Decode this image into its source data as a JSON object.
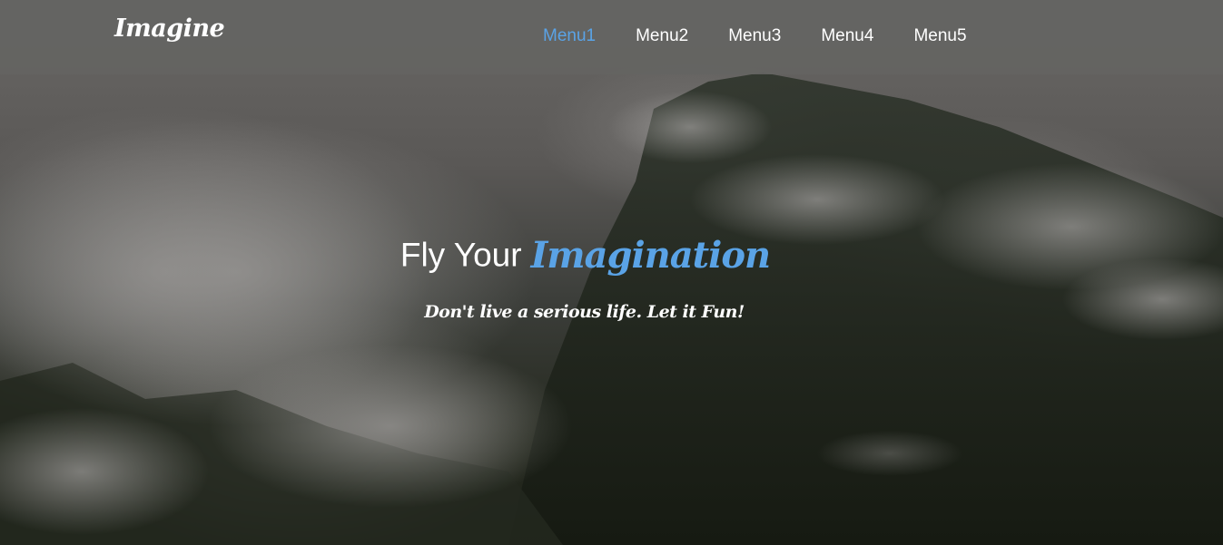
{
  "brand": {
    "logo_text": "Imagine"
  },
  "nav": {
    "items": [
      {
        "label": "Menu1",
        "active": true
      },
      {
        "label": "Menu2",
        "active": false
      },
      {
        "label": "Menu3",
        "active": false
      },
      {
        "label": "Menu4",
        "active": false
      },
      {
        "label": "Menu5",
        "active": false
      }
    ]
  },
  "hero": {
    "headline_plain": "Fly Your",
    "headline_accent": "Imagination",
    "tagline": "Don't live a serious life. Let it Fun!"
  },
  "colors": {
    "accent": "#5aa3e6",
    "navbar": "#646462",
    "text": "#ffffff"
  }
}
